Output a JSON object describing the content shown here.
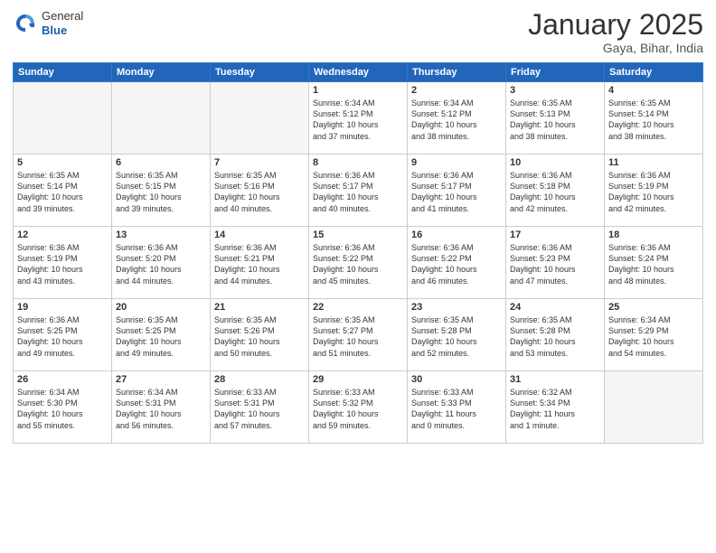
{
  "header": {
    "logo_general": "General",
    "logo_blue": "Blue",
    "title": "January 2025",
    "location": "Gaya, Bihar, India"
  },
  "weekdays": [
    "Sunday",
    "Monday",
    "Tuesday",
    "Wednesday",
    "Thursday",
    "Friday",
    "Saturday"
  ],
  "weeks": [
    [
      {
        "num": "",
        "text": ""
      },
      {
        "num": "",
        "text": ""
      },
      {
        "num": "",
        "text": ""
      },
      {
        "num": "1",
        "text": "Sunrise: 6:34 AM\nSunset: 5:12 PM\nDaylight: 10 hours\nand 37 minutes."
      },
      {
        "num": "2",
        "text": "Sunrise: 6:34 AM\nSunset: 5:12 PM\nDaylight: 10 hours\nand 38 minutes."
      },
      {
        "num": "3",
        "text": "Sunrise: 6:35 AM\nSunset: 5:13 PM\nDaylight: 10 hours\nand 38 minutes."
      },
      {
        "num": "4",
        "text": "Sunrise: 6:35 AM\nSunset: 5:14 PM\nDaylight: 10 hours\nand 38 minutes."
      }
    ],
    [
      {
        "num": "5",
        "text": "Sunrise: 6:35 AM\nSunset: 5:14 PM\nDaylight: 10 hours\nand 39 minutes."
      },
      {
        "num": "6",
        "text": "Sunrise: 6:35 AM\nSunset: 5:15 PM\nDaylight: 10 hours\nand 39 minutes."
      },
      {
        "num": "7",
        "text": "Sunrise: 6:35 AM\nSunset: 5:16 PM\nDaylight: 10 hours\nand 40 minutes."
      },
      {
        "num": "8",
        "text": "Sunrise: 6:36 AM\nSunset: 5:17 PM\nDaylight: 10 hours\nand 40 minutes."
      },
      {
        "num": "9",
        "text": "Sunrise: 6:36 AM\nSunset: 5:17 PM\nDaylight: 10 hours\nand 41 minutes."
      },
      {
        "num": "10",
        "text": "Sunrise: 6:36 AM\nSunset: 5:18 PM\nDaylight: 10 hours\nand 42 minutes."
      },
      {
        "num": "11",
        "text": "Sunrise: 6:36 AM\nSunset: 5:19 PM\nDaylight: 10 hours\nand 42 minutes."
      }
    ],
    [
      {
        "num": "12",
        "text": "Sunrise: 6:36 AM\nSunset: 5:19 PM\nDaylight: 10 hours\nand 43 minutes."
      },
      {
        "num": "13",
        "text": "Sunrise: 6:36 AM\nSunset: 5:20 PM\nDaylight: 10 hours\nand 44 minutes."
      },
      {
        "num": "14",
        "text": "Sunrise: 6:36 AM\nSunset: 5:21 PM\nDaylight: 10 hours\nand 44 minutes."
      },
      {
        "num": "15",
        "text": "Sunrise: 6:36 AM\nSunset: 5:22 PM\nDaylight: 10 hours\nand 45 minutes."
      },
      {
        "num": "16",
        "text": "Sunrise: 6:36 AM\nSunset: 5:22 PM\nDaylight: 10 hours\nand 46 minutes."
      },
      {
        "num": "17",
        "text": "Sunrise: 6:36 AM\nSunset: 5:23 PM\nDaylight: 10 hours\nand 47 minutes."
      },
      {
        "num": "18",
        "text": "Sunrise: 6:36 AM\nSunset: 5:24 PM\nDaylight: 10 hours\nand 48 minutes."
      }
    ],
    [
      {
        "num": "19",
        "text": "Sunrise: 6:36 AM\nSunset: 5:25 PM\nDaylight: 10 hours\nand 49 minutes."
      },
      {
        "num": "20",
        "text": "Sunrise: 6:35 AM\nSunset: 5:25 PM\nDaylight: 10 hours\nand 49 minutes."
      },
      {
        "num": "21",
        "text": "Sunrise: 6:35 AM\nSunset: 5:26 PM\nDaylight: 10 hours\nand 50 minutes."
      },
      {
        "num": "22",
        "text": "Sunrise: 6:35 AM\nSunset: 5:27 PM\nDaylight: 10 hours\nand 51 minutes."
      },
      {
        "num": "23",
        "text": "Sunrise: 6:35 AM\nSunset: 5:28 PM\nDaylight: 10 hours\nand 52 minutes."
      },
      {
        "num": "24",
        "text": "Sunrise: 6:35 AM\nSunset: 5:28 PM\nDaylight: 10 hours\nand 53 minutes."
      },
      {
        "num": "25",
        "text": "Sunrise: 6:34 AM\nSunset: 5:29 PM\nDaylight: 10 hours\nand 54 minutes."
      }
    ],
    [
      {
        "num": "26",
        "text": "Sunrise: 6:34 AM\nSunset: 5:30 PM\nDaylight: 10 hours\nand 55 minutes."
      },
      {
        "num": "27",
        "text": "Sunrise: 6:34 AM\nSunset: 5:31 PM\nDaylight: 10 hours\nand 56 minutes."
      },
      {
        "num": "28",
        "text": "Sunrise: 6:33 AM\nSunset: 5:31 PM\nDaylight: 10 hours\nand 57 minutes."
      },
      {
        "num": "29",
        "text": "Sunrise: 6:33 AM\nSunset: 5:32 PM\nDaylight: 10 hours\nand 59 minutes."
      },
      {
        "num": "30",
        "text": "Sunrise: 6:33 AM\nSunset: 5:33 PM\nDaylight: 11 hours\nand 0 minutes."
      },
      {
        "num": "31",
        "text": "Sunrise: 6:32 AM\nSunset: 5:34 PM\nDaylight: 11 hours\nand 1 minute."
      },
      {
        "num": "",
        "text": ""
      }
    ]
  ]
}
